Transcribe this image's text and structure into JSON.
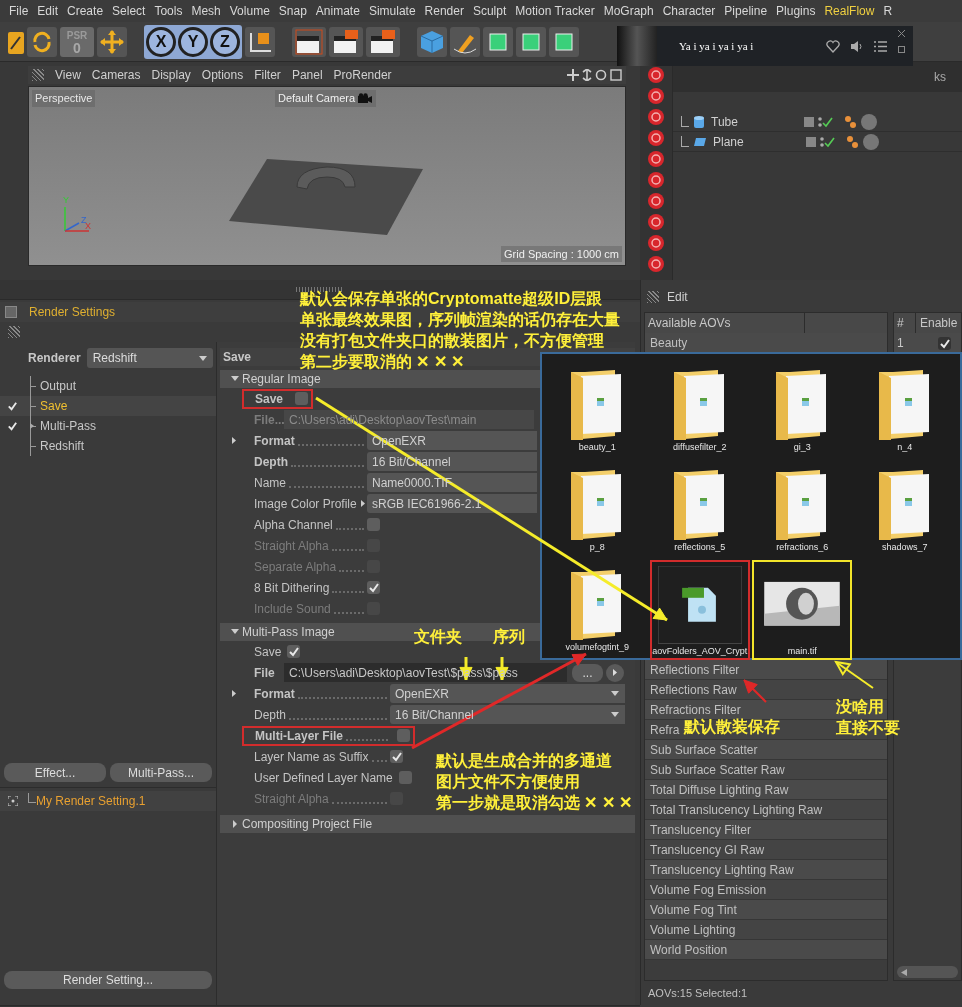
{
  "menu_bar": [
    {
      "label": "File",
      "highlighted": false
    },
    {
      "label": "Edit",
      "highlighted": false
    },
    {
      "label": "Create",
      "highlighted": false
    },
    {
      "label": "Select",
      "highlighted": false
    },
    {
      "label": "Tools",
      "highlighted": false
    },
    {
      "label": "Mesh",
      "highlighted": false
    },
    {
      "label": "Volume",
      "highlighted": false
    },
    {
      "label": "Snap",
      "highlighted": false
    },
    {
      "label": "Animate",
      "highlighted": false
    },
    {
      "label": "Simulate",
      "highlighted": false
    },
    {
      "label": "Render",
      "highlighted": false
    },
    {
      "label": "Sculpt",
      "highlighted": false
    },
    {
      "label": "Motion Tracker",
      "highlighted": false
    },
    {
      "label": "MoGraph",
      "highlighted": false
    },
    {
      "label": "Character",
      "highlighted": false
    },
    {
      "label": "Pipeline",
      "highlighted": false
    },
    {
      "label": "Plugins",
      "highlighted": false
    },
    {
      "label": "RealFlow",
      "highlighted": true
    },
    {
      "label": "R",
      "highlighted": false
    }
  ],
  "toolbar": {
    "psr_label": "PSR",
    "psr_value": "0",
    "axes": [
      {
        "label": "X",
        "active": true
      },
      {
        "label": "Y",
        "active": true
      },
      {
        "label": "Z",
        "active": true
      }
    ]
  },
  "music_player": {
    "title": "Ya i ya i ya i ya i"
  },
  "object_manager": {
    "tab_partial": "ks",
    "objects": [
      {
        "name": "Tube",
        "kind": "tube"
      },
      {
        "name": "Plane",
        "kind": "plane"
      }
    ]
  },
  "viewport": {
    "menu": [
      "View",
      "Cameras",
      "Display",
      "Options",
      "Filter",
      "Panel",
      "ProRender"
    ],
    "view_name": "Perspective",
    "camera": "Default Camera",
    "grid_spacing": "Grid Spacing : 1000 cm",
    "axes": [
      "Y",
      "Z",
      "X"
    ]
  },
  "render_settings": {
    "title": "Render Settings",
    "renderer_label": "Renderer",
    "renderer": "Redshift",
    "tree": [
      {
        "label": "Output",
        "checked": false,
        "selected": false,
        "expandable": false
      },
      {
        "label": "Save",
        "checked": true,
        "selected": true,
        "expandable": false
      },
      {
        "label": "Multi-Pass",
        "checked": true,
        "selected": false,
        "expandable": true
      },
      {
        "label": "Redshift",
        "checked": false,
        "selected": false,
        "expandable": false
      }
    ],
    "buttons": [
      "Effect...",
      "Multi-Pass..."
    ],
    "presets": [
      {
        "label": "My Render Setting.1"
      }
    ],
    "bottom_button": "Render Setting...",
    "page_title": "Save",
    "sections": [
      {
        "title": "Regular Image",
        "expanded": true,
        "rows": [
          {
            "kind": "checkbox",
            "label": "Save",
            "bold": true,
            "leader": false,
            "disabled": false,
            "expandable": false,
            "checked": false,
            "framed": true
          },
          {
            "kind": "path",
            "label": "File...",
            "bold": true,
            "leader": false,
            "disabled": true,
            "expandable": false,
            "value": "C:\\Users\\adi\\Desktop\\aovTest\\main"
          },
          {
            "kind": "dropdown",
            "label": "Format",
            "bold": true,
            "leader": true,
            "disabled": false,
            "expandable": true,
            "value": "OpenEXR"
          },
          {
            "kind": "dropdown",
            "label": "Depth",
            "bold": true,
            "leader": true,
            "disabled": false,
            "expandable": false,
            "value": "16 Bit/Channel"
          },
          {
            "kind": "dropdown",
            "label": "Name",
            "bold": false,
            "leader": true,
            "disabled": false,
            "expandable": false,
            "value": "Name0000.TIF"
          },
          {
            "kind": "profile",
            "label": "Image Color Profile",
            "bold": false,
            "leader": false,
            "disabled": false,
            "expandable": false,
            "value": "sRGB IEC61966-2.1"
          },
          {
            "kind": "checkbox",
            "label": "Alpha Channel",
            "bold": false,
            "leader": true,
            "disabled": false,
            "expandable": false,
            "checked": false
          },
          {
            "kind": "checkbox",
            "label": "Straight Alpha",
            "bold": false,
            "leader": true,
            "disabled": true,
            "expandable": false,
            "checked": false
          },
          {
            "kind": "checkbox",
            "label": "Separate Alpha",
            "bold": false,
            "leader": true,
            "disabled": true,
            "expandable": false,
            "checked": false
          },
          {
            "kind": "checkbox",
            "label": "8 Bit Dithering",
            "bold": false,
            "leader": true,
            "disabled": false,
            "expandable": false,
            "checked": true
          },
          {
            "kind": "checkbox",
            "label": "Include Sound",
            "bold": false,
            "leader": true,
            "disabled": true,
            "expandable": false,
            "checked": false
          }
        ]
      },
      {
        "title": "Multi-Pass Image",
        "expanded": true,
        "rows": [
          {
            "kind": "checkbox",
            "label": "Save",
            "bold": false,
            "leader": false,
            "disabled": false,
            "expandable": false,
            "checked": true
          },
          {
            "kind": "path",
            "label": "File",
            "bold": true,
            "leader": false,
            "disabled": false,
            "expandable": false,
            "value": "C:\\Users\\adi\\Desktop\\aovTest\\$pass\\$pass",
            "browse": "..."
          },
          {
            "kind": "dropdown",
            "label": "Format",
            "bold": true,
            "leader": true,
            "disabled": false,
            "expandable": true,
            "value": "OpenEXR"
          },
          {
            "kind": "dropdown",
            "label": "Depth",
            "bold": false,
            "leader": true,
            "disabled": false,
            "expandable": false,
            "value": "16 Bit/Channel"
          },
          {
            "kind": "checkbox",
            "label": "Multi-Layer File",
            "bold": true,
            "leader": true,
            "disabled": false,
            "expandable": false,
            "checked": false,
            "framed": true
          },
          {
            "kind": "checkbox",
            "label": "Layer Name as Suffix",
            "bold": false,
            "leader": true,
            "disabled": false,
            "expandable": false,
            "checked": true
          },
          {
            "kind": "checkbox",
            "label": "User Defined Layer Name",
            "bold": false,
            "leader": false,
            "disabled": false,
            "expandable": false,
            "checked": false
          },
          {
            "kind": "checkbox",
            "label": "Straight Alpha",
            "bold": false,
            "leader": true,
            "disabled": true,
            "expandable": false,
            "checked": false
          }
        ]
      },
      {
        "title": "Compositing Project File",
        "expanded": false
      }
    ]
  },
  "aov_panel": {
    "menu": "Edit",
    "list_header": "Available AOVs",
    "columns": [
      "#",
      "Enable"
    ],
    "enabled_rows": [
      {
        "number": "1",
        "enabled": true
      }
    ],
    "aovs_top": [
      "Beauty"
    ],
    "aovs": [
      "Reflections Filter",
      "Reflections Raw",
      "Refractions Filter",
      "Refra",
      "Sub Surface Scatter",
      "Sub Surface Scatter Raw",
      "Total Diffuse Lighting Raw",
      "Total Translucency Lighting Raw",
      "Translucency Filter",
      "Translucency GI Raw",
      "Translucency Lighting Raw",
      "Volume Fog Emission",
      "Volume Fog Tint",
      "Volume Lighting",
      "World Position"
    ],
    "status": "AOVs:15 Selected:1"
  },
  "file_browser": {
    "items": [
      {
        "name": "beauty_1",
        "kind": "folder",
        "framed": false
      },
      {
        "name": "diffusefilter_2",
        "kind": "folder",
        "framed": false
      },
      {
        "name": "gi_3",
        "kind": "folder",
        "framed": false
      },
      {
        "name": "n_4",
        "kind": "folder",
        "framed": false
      },
      {
        "name": "p_8",
        "kind": "folder",
        "framed": false
      },
      {
        "name": "reflections_5",
        "kind": "folder",
        "framed": false
      },
      {
        "name": "refractions_6",
        "kind": "folder",
        "framed": false
      },
      {
        "name": "shadows_7",
        "kind": "folder",
        "framed": false
      },
      {
        "name": "volumefogtint_9",
        "kind": "folder",
        "framed": false
      },
      {
        "name": "aovFolders_AOV_Crypt",
        "kind": "pic",
        "framed": true
      },
      {
        "name": "main.tif",
        "kind": "image",
        "framed": true
      }
    ]
  },
  "annotations": [
    {
      "lines": [
        "默认会保存单张的Cryptomatte超级ID层跟",
        "单张最终效果图，序列帧渲染的话仍存在大量",
        "没有打包文件夹口的散装图片，不方便管理",
        "第二步要取消的 ✕ ✕ ✕"
      ]
    },
    {
      "lines": [
        "文件夹"
      ]
    },
    {
      "lines": [
        "序列"
      ]
    },
    {
      "lines": [
        "默认是生成合并的多通道",
        "图片文件不方便使用",
        "第一步就是取消勾选 ✕ ✕ ✕"
      ]
    },
    {
      "lines": [
        "默认散装保存"
      ]
    },
    {
      "lines": [
        "没啥用",
        "直接不要"
      ]
    }
  ]
}
